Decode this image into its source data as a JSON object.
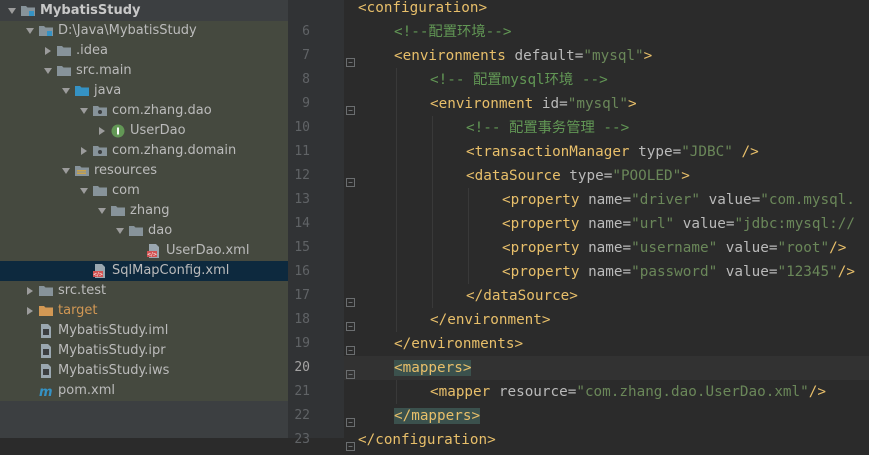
{
  "project_tree": {
    "rows": [
      {
        "label": "MybatisStudy",
        "indent": 4,
        "arrow": "down",
        "icon": "project",
        "bold": true
      },
      {
        "label": "D:\\Java\\MybatisStudy",
        "indent": 22,
        "arrow": "down",
        "icon": "module-folder"
      },
      {
        "label": ".idea",
        "indent": 40,
        "arrow": "right",
        "icon": "folder"
      },
      {
        "label": "src.main",
        "indent": 40,
        "arrow": "down",
        "icon": "folder"
      },
      {
        "label": "java",
        "indent": 58,
        "arrow": "down",
        "icon": "source-folder"
      },
      {
        "label": "com.zhang.dao",
        "indent": 76,
        "arrow": "down",
        "icon": "package"
      },
      {
        "label": "UserDao",
        "indent": 94,
        "arrow": "right",
        "icon": "interface"
      },
      {
        "label": "com.zhang.domain",
        "indent": 76,
        "arrow": "right",
        "icon": "package"
      },
      {
        "label": "resources",
        "indent": 58,
        "arrow": "down",
        "icon": "resources-folder"
      },
      {
        "label": "com",
        "indent": 76,
        "arrow": "down",
        "icon": "folder"
      },
      {
        "label": "zhang",
        "indent": 94,
        "arrow": "down",
        "icon": "folder"
      },
      {
        "label": "dao",
        "indent": 112,
        "arrow": "down",
        "icon": "folder"
      },
      {
        "label": "UserDao.xml",
        "indent": 130,
        "arrow": "none",
        "icon": "xml-file"
      },
      {
        "label": "SqlMapConfig.xml",
        "indent": 76,
        "arrow": "none",
        "icon": "xml-file",
        "selected": true
      },
      {
        "label": "src.test",
        "indent": 22,
        "arrow": "right",
        "icon": "folder"
      },
      {
        "label": "target",
        "indent": 22,
        "arrow": "right",
        "icon": "excluded-folder",
        "orange": true
      },
      {
        "label": "MybatisStudy.iml",
        "indent": 22,
        "arrow": "none",
        "icon": "iml-file"
      },
      {
        "label": "MybatisStudy.ipr",
        "indent": 22,
        "arrow": "none",
        "icon": "ipr-file"
      },
      {
        "label": "MybatisStudy.iws",
        "indent": 22,
        "arrow": "none",
        "icon": "iws-file"
      },
      {
        "label": "pom.xml",
        "indent": 22,
        "arrow": "none",
        "icon": "maven-icon"
      }
    ]
  },
  "editor": {
    "current_line": "20",
    "lines": [
      {
        "num": "",
        "indent": 0,
        "tokens": [
          {
            "k": "t",
            "s": "<configuration>"
          }
        ],
        "fold": false
      },
      {
        "num": "6",
        "indent": 1,
        "tokens": [
          {
            "k": "c",
            "s": "<!--配置环境-->"
          }
        ],
        "fold": false
      },
      {
        "num": "7",
        "indent": 1,
        "tokens": [
          {
            "k": "t",
            "s": "<environments "
          },
          {
            "k": "a",
            "s": "default="
          },
          {
            "k": "v",
            "s": "\"mysql\""
          },
          {
            "k": "t",
            "s": ">"
          }
        ],
        "fold": true
      },
      {
        "num": "8",
        "indent": 2,
        "tokens": [
          {
            "k": "c",
            "s": "<!-- 配置mysql环境 -->"
          }
        ],
        "fold": false
      },
      {
        "num": "9",
        "indent": 2,
        "tokens": [
          {
            "k": "t",
            "s": "<environment "
          },
          {
            "k": "a",
            "s": "id="
          },
          {
            "k": "v",
            "s": "\"mysql\""
          },
          {
            "k": "t",
            "s": ">"
          }
        ],
        "fold": true
      },
      {
        "num": "10",
        "indent": 3,
        "tokens": [
          {
            "k": "c",
            "s": "<!-- 配置事务管理 -->"
          }
        ],
        "fold": false
      },
      {
        "num": "11",
        "indent": 3,
        "tokens": [
          {
            "k": "t",
            "s": "<transactionManager "
          },
          {
            "k": "a",
            "s": "type="
          },
          {
            "k": "v",
            "s": "\"JDBC\""
          },
          {
            "k": "t",
            "s": " />"
          }
        ],
        "fold": false
      },
      {
        "num": "12",
        "indent": 3,
        "tokens": [
          {
            "k": "t",
            "s": "<dataSource "
          },
          {
            "k": "a",
            "s": "type="
          },
          {
            "k": "v",
            "s": "\"POOLED\""
          },
          {
            "k": "t",
            "s": ">"
          }
        ],
        "fold": true
      },
      {
        "num": "13",
        "indent": 4,
        "tokens": [
          {
            "k": "t",
            "s": "<property "
          },
          {
            "k": "a",
            "s": "name="
          },
          {
            "k": "v",
            "s": "\"driver\""
          },
          {
            "k": "a",
            "s": " value="
          },
          {
            "k": "v",
            "s": "\"com.mysql."
          }
        ],
        "fold": false
      },
      {
        "num": "14",
        "indent": 4,
        "tokens": [
          {
            "k": "t",
            "s": "<property "
          },
          {
            "k": "a",
            "s": "name="
          },
          {
            "k": "v",
            "s": "\"url\""
          },
          {
            "k": "a",
            "s": " value="
          },
          {
            "k": "v",
            "s": "\"jdbc:mysql://"
          }
        ],
        "fold": false
      },
      {
        "num": "15",
        "indent": 4,
        "tokens": [
          {
            "k": "t",
            "s": "<property "
          },
          {
            "k": "a",
            "s": "name="
          },
          {
            "k": "v",
            "s": "\"username\""
          },
          {
            "k": "a",
            "s": " value="
          },
          {
            "k": "v",
            "s": "\"root\""
          },
          {
            "k": "t",
            "s": "/>"
          }
        ],
        "fold": false
      },
      {
        "num": "16",
        "indent": 4,
        "tokens": [
          {
            "k": "t",
            "s": "<property "
          },
          {
            "k": "a",
            "s": "name="
          },
          {
            "k": "v",
            "s": "\"password\""
          },
          {
            "k": "a",
            "s": " value="
          },
          {
            "k": "v",
            "s": "\"12345\""
          },
          {
            "k": "t",
            "s": "/>"
          }
        ],
        "fold": false
      },
      {
        "num": "17",
        "indent": 3,
        "tokens": [
          {
            "k": "t",
            "s": "</dataSource>"
          }
        ],
        "fold": true
      },
      {
        "num": "18",
        "indent": 2,
        "tokens": [
          {
            "k": "t",
            "s": "</environment>"
          }
        ],
        "fold": true
      },
      {
        "num": "19",
        "indent": 1,
        "tokens": [
          {
            "k": "t",
            "s": "</environments>"
          }
        ],
        "fold": true
      },
      {
        "num": "20",
        "indent": 1,
        "tokens": [
          {
            "k": "t",
            "s": "<mappers>",
            "hl": true
          }
        ],
        "fold": true
      },
      {
        "num": "21",
        "indent": 2,
        "tokens": [
          {
            "k": "t",
            "s": "<mapper "
          },
          {
            "k": "a",
            "s": "resource="
          },
          {
            "k": "v",
            "s": "\"com.zhang.dao.UserDao.xml\""
          },
          {
            "k": "t",
            "s": "/>"
          }
        ],
        "fold": false
      },
      {
        "num": "22",
        "indent": 1,
        "tokens": [
          {
            "k": "t",
            "s": "</mappers>",
            "hl": true
          }
        ],
        "fold": true
      },
      {
        "num": "23",
        "indent": 0,
        "tokens": [
          {
            "k": "t",
            "s": "</configuration>"
          }
        ],
        "fold": true
      }
    ]
  }
}
